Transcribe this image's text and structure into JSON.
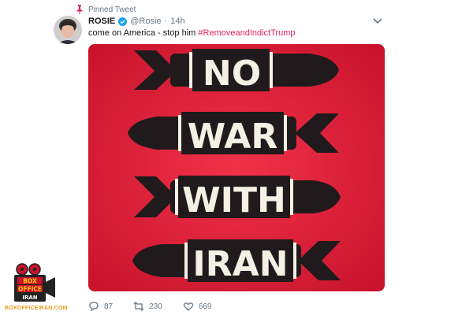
{
  "pinned_label": "Pinned Tweet",
  "tweet": {
    "name": "ROSIE",
    "handle": "@Rosie",
    "separator": "·",
    "time": "14h",
    "text": "come on America - stop him ",
    "hashtag": "#RemoveandIndictTrump"
  },
  "poster": {
    "words": [
      "NO",
      "WAR",
      "WITH",
      "IRAN"
    ],
    "background": "#e8203a",
    "bomb_color": "#201a1c",
    "text_color": "#f5f0e4"
  },
  "actions": {
    "replies": "87",
    "retweets": "230",
    "likes": "669"
  },
  "watermark": {
    "line1": "BOX",
    "line2": "OFFICE",
    "line3": "IRAN",
    "url": "BOXOFFICEIRAN.COM"
  },
  "colors": {
    "accent": "#1da1f2",
    "hashtag": "#e0245e",
    "muted": "#657786",
    "pin": "#e0245e"
  }
}
